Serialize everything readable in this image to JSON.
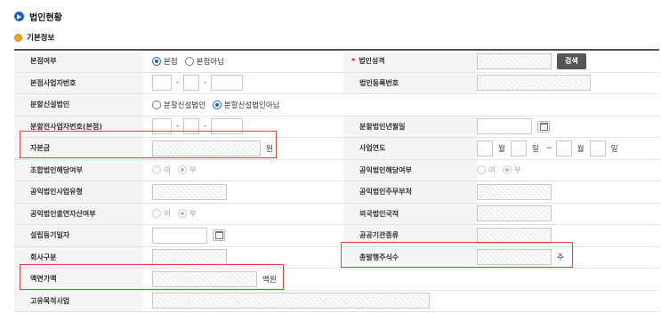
{
  "page": {
    "title": "법인현황",
    "section": "기본정보"
  },
  "rows": {
    "r1": {
      "label": "본점여부",
      "opt1": "본점",
      "opt2": "본점아님",
      "label2": "법인성격",
      "required": "*",
      "search": "검색"
    },
    "r2": {
      "label": "본점사업자번호",
      "sep1": "-",
      "sep2": "-",
      "label2": "법인등록번호"
    },
    "r3": {
      "label": "분할신설법인",
      "opt1": "분할신설법인",
      "opt2": "분할신설법인아님"
    },
    "r4": {
      "label": "분할전사업자번호(본점)",
      "sep1": "-",
      "sep2": "-",
      "label2": "분할법인년월일"
    },
    "r5": {
      "label": "자본금",
      "unit": "원",
      "label2": "사업연도",
      "month1": "월",
      "day1": "일",
      "tilde": "~",
      "month2": "월",
      "day2": "일"
    },
    "r6": {
      "label": "조합법인해당여부",
      "opt1": "여",
      "opt2": "부",
      "label2": "공익법인해당여부",
      "opt3": "여",
      "opt4": "부"
    },
    "r7": {
      "label": "공익법인사업유형",
      "label2": "공익법인주무부처"
    },
    "r8": {
      "label": "공익법인출연자산여부",
      "opt1": "여",
      "opt2": "부",
      "label2": "외국법인국적"
    },
    "r9": {
      "label": "설립등기일자",
      "label2": "공공기관종류"
    },
    "r10": {
      "label": "회사구분",
      "label2": "총발행주식수",
      "unit": "주"
    },
    "r11": {
      "label": "액면가액",
      "unit": "백원"
    },
    "r12": {
      "label": "고유목적사업"
    }
  },
  "colors": {
    "accent": "#1e63c4",
    "highlight": "#d9483a",
    "section_dot": "#f0a020"
  }
}
